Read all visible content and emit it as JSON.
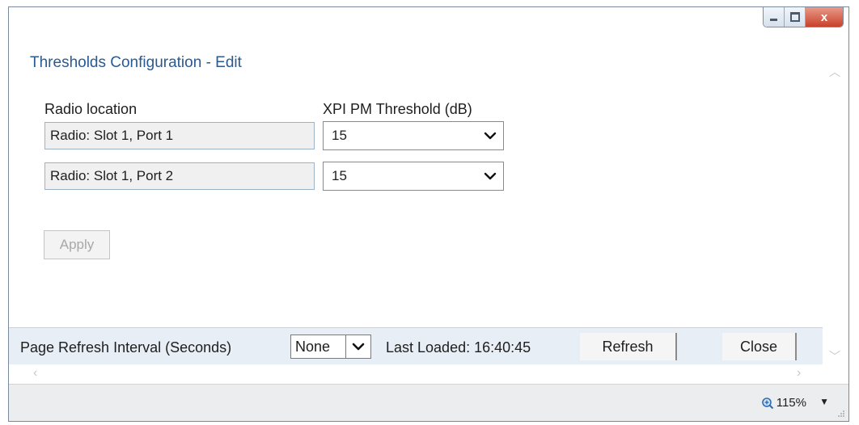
{
  "window": {
    "controls": {
      "close_symbol": "x"
    }
  },
  "dialog": {
    "title": "Thresholds Configuration - Edit",
    "columns": {
      "location": "Radio location",
      "threshold": "XPI PM Threshold (dB)"
    },
    "rows": [
      {
        "location": "Radio: Slot 1, Port 1",
        "threshold": "15"
      },
      {
        "location": "Radio: Slot 1, Port 2",
        "threshold": "15"
      }
    ],
    "apply_label": "Apply"
  },
  "footer": {
    "refresh_interval_label": "Page Refresh Interval (Seconds)",
    "refresh_interval_value": "None",
    "last_loaded": "Last Loaded: 16:40:45",
    "refresh_label": "Refresh",
    "close_label": "Close"
  },
  "statusbar": {
    "zoom": "115%"
  },
  "colors": {
    "title_blue": "#2a5a92",
    "footer_bg": "#e8eef6"
  }
}
